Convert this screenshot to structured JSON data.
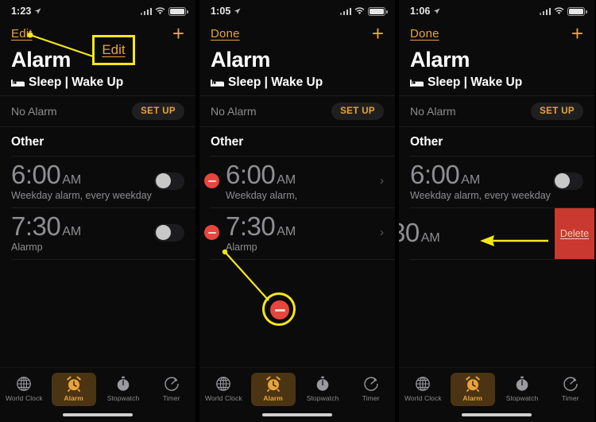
{
  "panels": [
    {
      "status": {
        "time": "1:23",
        "location_icon": "location-arrow-icon",
        "signal_icon": "cellular-bars-icon",
        "wifi_icon": "wifi-icon",
        "battery_icon": "battery-icon"
      },
      "nav": {
        "left_label": "Edit",
        "right_icon": "plus-icon"
      },
      "title": "Alarm",
      "sleep_row": {
        "icon": "bed-icon",
        "label": "Sleep | Wake Up"
      },
      "no_alarm": {
        "label": "No Alarm",
        "button": "SET UP"
      },
      "section_header": "Other",
      "alarms": [
        {
          "time": "6:00",
          "meridiem": "AM",
          "subtitle": "Weekday alarm, every weekday",
          "toggle_on": false,
          "editing": false
        },
        {
          "time": "7:30",
          "meridiem": "AM",
          "subtitle": "Alarmp",
          "toggle_on": false,
          "editing": false
        }
      ],
      "tabs": [
        {
          "label": "World Clock",
          "icon": "globe-icon",
          "active": false
        },
        {
          "label": "Alarm",
          "icon": "alarm-clock-icon",
          "active": true
        },
        {
          "label": "Stopwatch",
          "icon": "stopwatch-icon",
          "active": false
        },
        {
          "label": "Timer",
          "icon": "timer-icon",
          "active": false
        }
      ]
    },
    {
      "status": {
        "time": "1:05",
        "location_icon": "location-arrow-icon",
        "signal_icon": "cellular-bars-icon",
        "wifi_icon": "wifi-icon",
        "battery_icon": "battery-icon"
      },
      "nav": {
        "left_label": "Done",
        "right_icon": "plus-icon"
      },
      "title": "Alarm",
      "sleep_row": {
        "icon": "bed-icon",
        "label": "Sleep | Wake Up"
      },
      "no_alarm": {
        "label": "No Alarm",
        "button": "SET UP"
      },
      "section_header": "Other",
      "alarms": [
        {
          "time": "6:00",
          "meridiem": "AM",
          "subtitle": "Weekday alarm,",
          "toggle_on": false,
          "editing": true
        },
        {
          "time": "7:30",
          "meridiem": "AM",
          "subtitle": "Alarmp",
          "toggle_on": false,
          "editing": true
        }
      ],
      "tabs": [
        {
          "label": "World Clock",
          "icon": "globe-icon",
          "active": false
        },
        {
          "label": "Alarm",
          "icon": "alarm-clock-icon",
          "active": true
        },
        {
          "label": "Stopwatch",
          "icon": "stopwatch-icon",
          "active": false
        },
        {
          "label": "Timer",
          "icon": "timer-icon",
          "active": false
        }
      ]
    },
    {
      "status": {
        "time": "1:06",
        "location_icon": "location-arrow-icon",
        "signal_icon": "cellular-bars-icon",
        "wifi_icon": "wifi-icon",
        "battery_icon": "battery-icon"
      },
      "nav": {
        "left_label": "Done",
        "right_icon": "plus-icon"
      },
      "title": "Alarm",
      "sleep_row": {
        "icon": "bed-icon",
        "label": "Sleep | Wake Up"
      },
      "no_alarm": {
        "label": "No Alarm",
        "button": "SET UP"
      },
      "section_header": "Other",
      "alarms": [
        {
          "time": "6:00",
          "meridiem": "AM",
          "subtitle": "Weekday alarm, every weekday",
          "toggle_on": false,
          "editing": false
        }
      ],
      "swiped_alarm": {
        "time": "30",
        "meridiem": "AM",
        "delete_label": "Delete"
      },
      "tabs": [
        {
          "label": "World Clock",
          "icon": "globe-icon",
          "active": false
        },
        {
          "label": "Alarm",
          "icon": "alarm-clock-icon",
          "active": true
        },
        {
          "label": "Stopwatch",
          "icon": "stopwatch-icon",
          "active": false
        },
        {
          "label": "Timer",
          "icon": "timer-icon",
          "active": false
        }
      ]
    }
  ],
  "annotations": {
    "edit_callout_label": "Edit",
    "highlight_color": "#f5e71a",
    "delete_color": "#c9392f",
    "accent_color": "#e8a33d",
    "minus_circle_label": "remove-alarm-button",
    "arrow_direction": "left"
  }
}
